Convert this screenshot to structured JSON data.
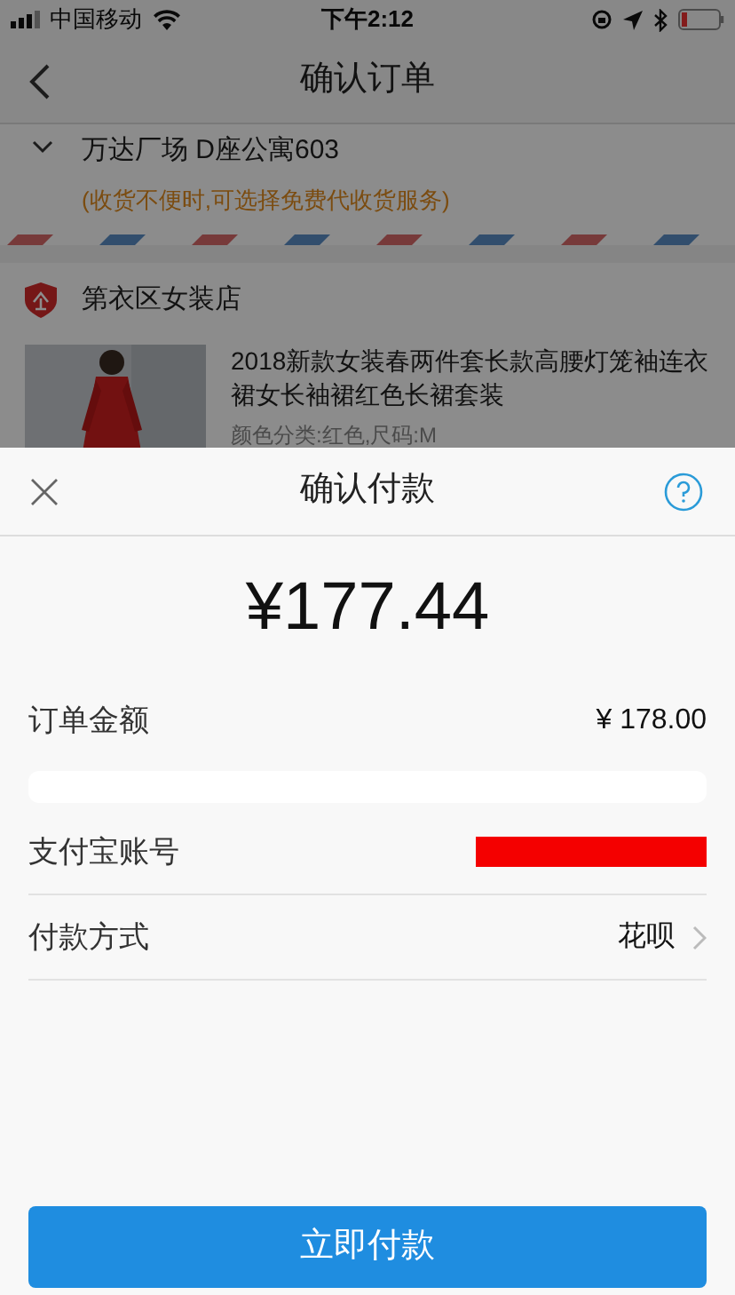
{
  "status_bar": {
    "carrier": "中国移动",
    "time": "下午2:12"
  },
  "nav": {
    "title": "确认订单"
  },
  "address": {
    "line": "万达厂场 D座公寓603",
    "note": "(收货不便时,可选择免费代收货服务)"
  },
  "store": {
    "name": "第衣区女装店"
  },
  "product": {
    "title": "2018新款女装春两件套长款高腰灯笼袖连衣裙女长袖裙红色长裙套装",
    "spec": "颜色分类:红色,尺码:M"
  },
  "payment_sheet": {
    "title": "确认付款",
    "amount": "¥177.44",
    "rows": [
      {
        "label": "订单金额",
        "value": "¥ 178.00",
        "redacted": false,
        "chevron": false
      },
      {
        "label": "支付宝账号",
        "redacted": true,
        "chevron": false
      },
      {
        "label": "付款方式",
        "value": "花呗",
        "redacted": false,
        "chevron": true
      }
    ],
    "pay_button": "立即付款"
  }
}
